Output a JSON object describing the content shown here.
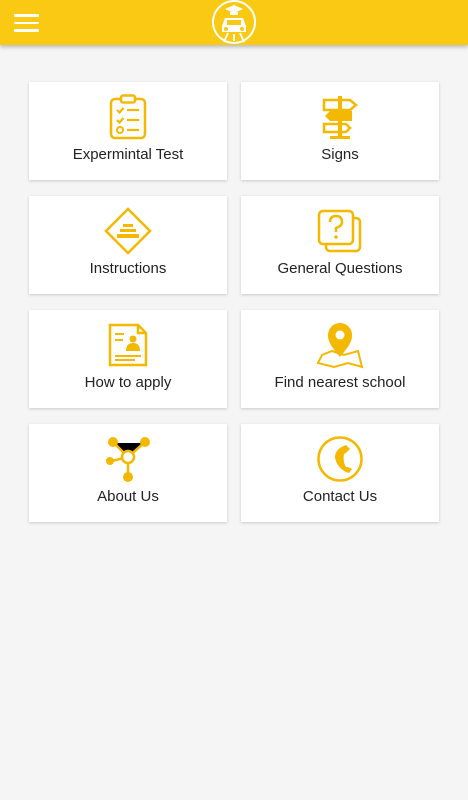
{
  "colors": {
    "accent": "#f9c913",
    "icon": "#f5b800",
    "background": "#f5f5f5"
  },
  "appbar": {
    "menu_icon": "hamburger-menu-icon",
    "logo_icon": "driving-school-car-logo-icon"
  },
  "tiles": [
    {
      "label": "Expermintal Test",
      "icon": "clipboard-checklist-icon"
    },
    {
      "label": "Signs",
      "icon": "signpost-icon"
    },
    {
      "label": "Instructions",
      "icon": "road-warning-sign-icon"
    },
    {
      "label": "General Questions",
      "icon": "question-cards-icon"
    },
    {
      "label": "How to apply",
      "icon": "resume-document-icon"
    },
    {
      "label": "Find nearest school",
      "icon": "map-pin-icon"
    },
    {
      "label": "About Us",
      "icon": "network-nodes-icon"
    },
    {
      "label": "Contact Us",
      "icon": "phone-circle-icon"
    }
  ]
}
